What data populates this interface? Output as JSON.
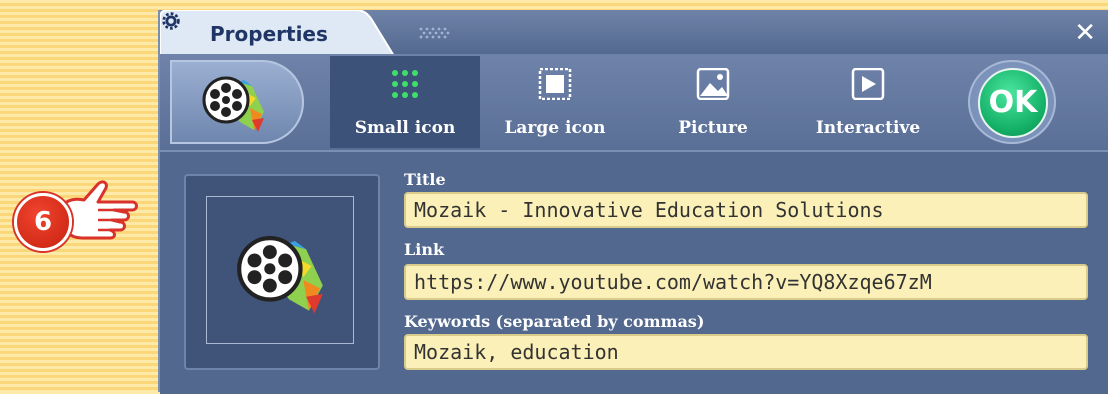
{
  "callout": {
    "step_number": "6"
  },
  "window": {
    "title": "Properties",
    "close_symbol": "✕"
  },
  "toolbar": {
    "tabs": [
      {
        "label": "Small icon",
        "icon": "small-icon-grid",
        "active": true
      },
      {
        "label": "Large icon",
        "icon": "large-icon-frame",
        "active": false
      },
      {
        "label": "Picture",
        "icon": "picture-icon",
        "active": false
      },
      {
        "label": "Interactive",
        "icon": "interactive-play-icon",
        "active": false
      }
    ],
    "ok_label": "OK"
  },
  "form": {
    "title_label": "Title",
    "title_value": "Mozaik - Innovative Education Solutions",
    "link_label": "Link",
    "link_value": "https://www.youtube.com/watch?v=YQ8Xzqe67zM",
    "keywords_label": "Keywords (separated by commas)",
    "keywords_value": "Mozaik, education"
  },
  "colors": {
    "panel": "#53688e",
    "active_tab": "#3d5278",
    "input_bg": "#fbf1b8",
    "ok_green": "#14b066",
    "badge_red": "#d8322a"
  }
}
